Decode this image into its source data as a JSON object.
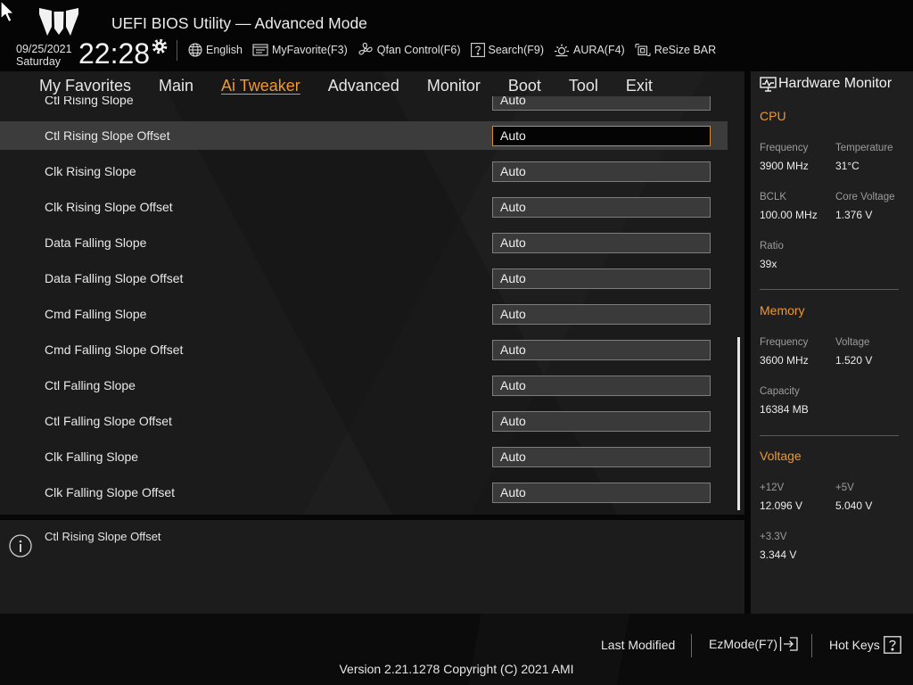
{
  "header": {
    "title": "UEFI BIOS Utility — Advanced Mode",
    "date": "09/25/2021",
    "day": "Saturday",
    "time": "22:28",
    "time_icon": "gear-icon",
    "toolbar": [
      {
        "label": "English",
        "icon": "globe-icon"
      },
      {
        "label": "MyFavorite(F3)",
        "icon": "my-favorite-icon"
      },
      {
        "label": "Qfan Control(F6)",
        "icon": "fan-icon"
      },
      {
        "label": "Search(F9)",
        "icon": "search-icon"
      },
      {
        "label": "AURA(F4)",
        "icon": "aura-icon"
      },
      {
        "label": "ReSize BAR",
        "icon": "resize-bar-icon"
      }
    ]
  },
  "menu": {
    "tabs": [
      {
        "label": "My Favorites"
      },
      {
        "label": "Main"
      },
      {
        "label": "Ai Tweaker"
      },
      {
        "label": "Advanced"
      },
      {
        "label": "Monitor"
      },
      {
        "label": "Boot"
      },
      {
        "label": "Tool"
      },
      {
        "label": "Exit"
      }
    ],
    "active_tab": "Ai Tweaker"
  },
  "settings": {
    "rows": [
      {
        "label": "Ctl Rising Slope",
        "value": "Auto"
      },
      {
        "label": "Ctl Rising Slope Offset",
        "value": "Auto",
        "selected": true
      },
      {
        "label": "Clk Rising Slope",
        "value": "Auto"
      },
      {
        "label": "Clk Rising Slope Offset",
        "value": "Auto"
      },
      {
        "label": "Data Falling Slope",
        "value": "Auto"
      },
      {
        "label": "Data Falling Slope Offset",
        "value": "Auto"
      },
      {
        "label": "Cmd Falling Slope",
        "value": "Auto"
      },
      {
        "label": "Cmd Falling Slope Offset",
        "value": "Auto"
      },
      {
        "label": "Ctl Falling Slope",
        "value": "Auto"
      },
      {
        "label": "Ctl Falling Slope Offset",
        "value": "Auto"
      },
      {
        "label": "Clk Falling Slope",
        "value": "Auto"
      },
      {
        "label": "Clk Falling Slope Offset",
        "value": "Auto"
      }
    ]
  },
  "help": {
    "icon": "info-icon",
    "text": "Ctl Rising Slope Offset"
  },
  "hardware_monitor": {
    "icon": "monitor-icon",
    "title": "Hardware Monitor",
    "sections": [
      {
        "heading": "CPU",
        "fields": [
          {
            "label": "Frequency",
            "value": "3900 MHz"
          },
          {
            "label": "Temperature",
            "value": "31°C"
          },
          {
            "label": "BCLK",
            "value": "100.00 MHz"
          },
          {
            "label": "Core Voltage",
            "value": "1.376 V"
          },
          {
            "label": "Ratio",
            "value": "39x"
          }
        ]
      },
      {
        "heading": "Memory",
        "fields": [
          {
            "label": "Frequency",
            "value": "3600 MHz"
          },
          {
            "label": "Voltage",
            "value": "1.520 V"
          },
          {
            "label": "Capacity",
            "value": "16384 MB"
          }
        ]
      },
      {
        "heading": "Voltage",
        "fields": [
          {
            "label": "+12V",
            "value": "12.096 V"
          },
          {
            "label": "+5V",
            "value": "5.040 V"
          },
          {
            "label": "+3.3V",
            "value": "3.344 V"
          }
        ]
      }
    ]
  },
  "footer": {
    "last_modified": "Last Modified",
    "ez_mode": "EzMode(F7)",
    "ez_mode_icon": "exit-icon",
    "hot_keys": "Hot Keys",
    "hot_keys_icon": "help-icon",
    "version": "Version 2.21.1278 Copyright (C) 2021 AMI"
  },
  "colors": {
    "accent": "#f0982e",
    "selected_row": "#3c3c3c",
    "selected_value_border": "#d48a30"
  }
}
